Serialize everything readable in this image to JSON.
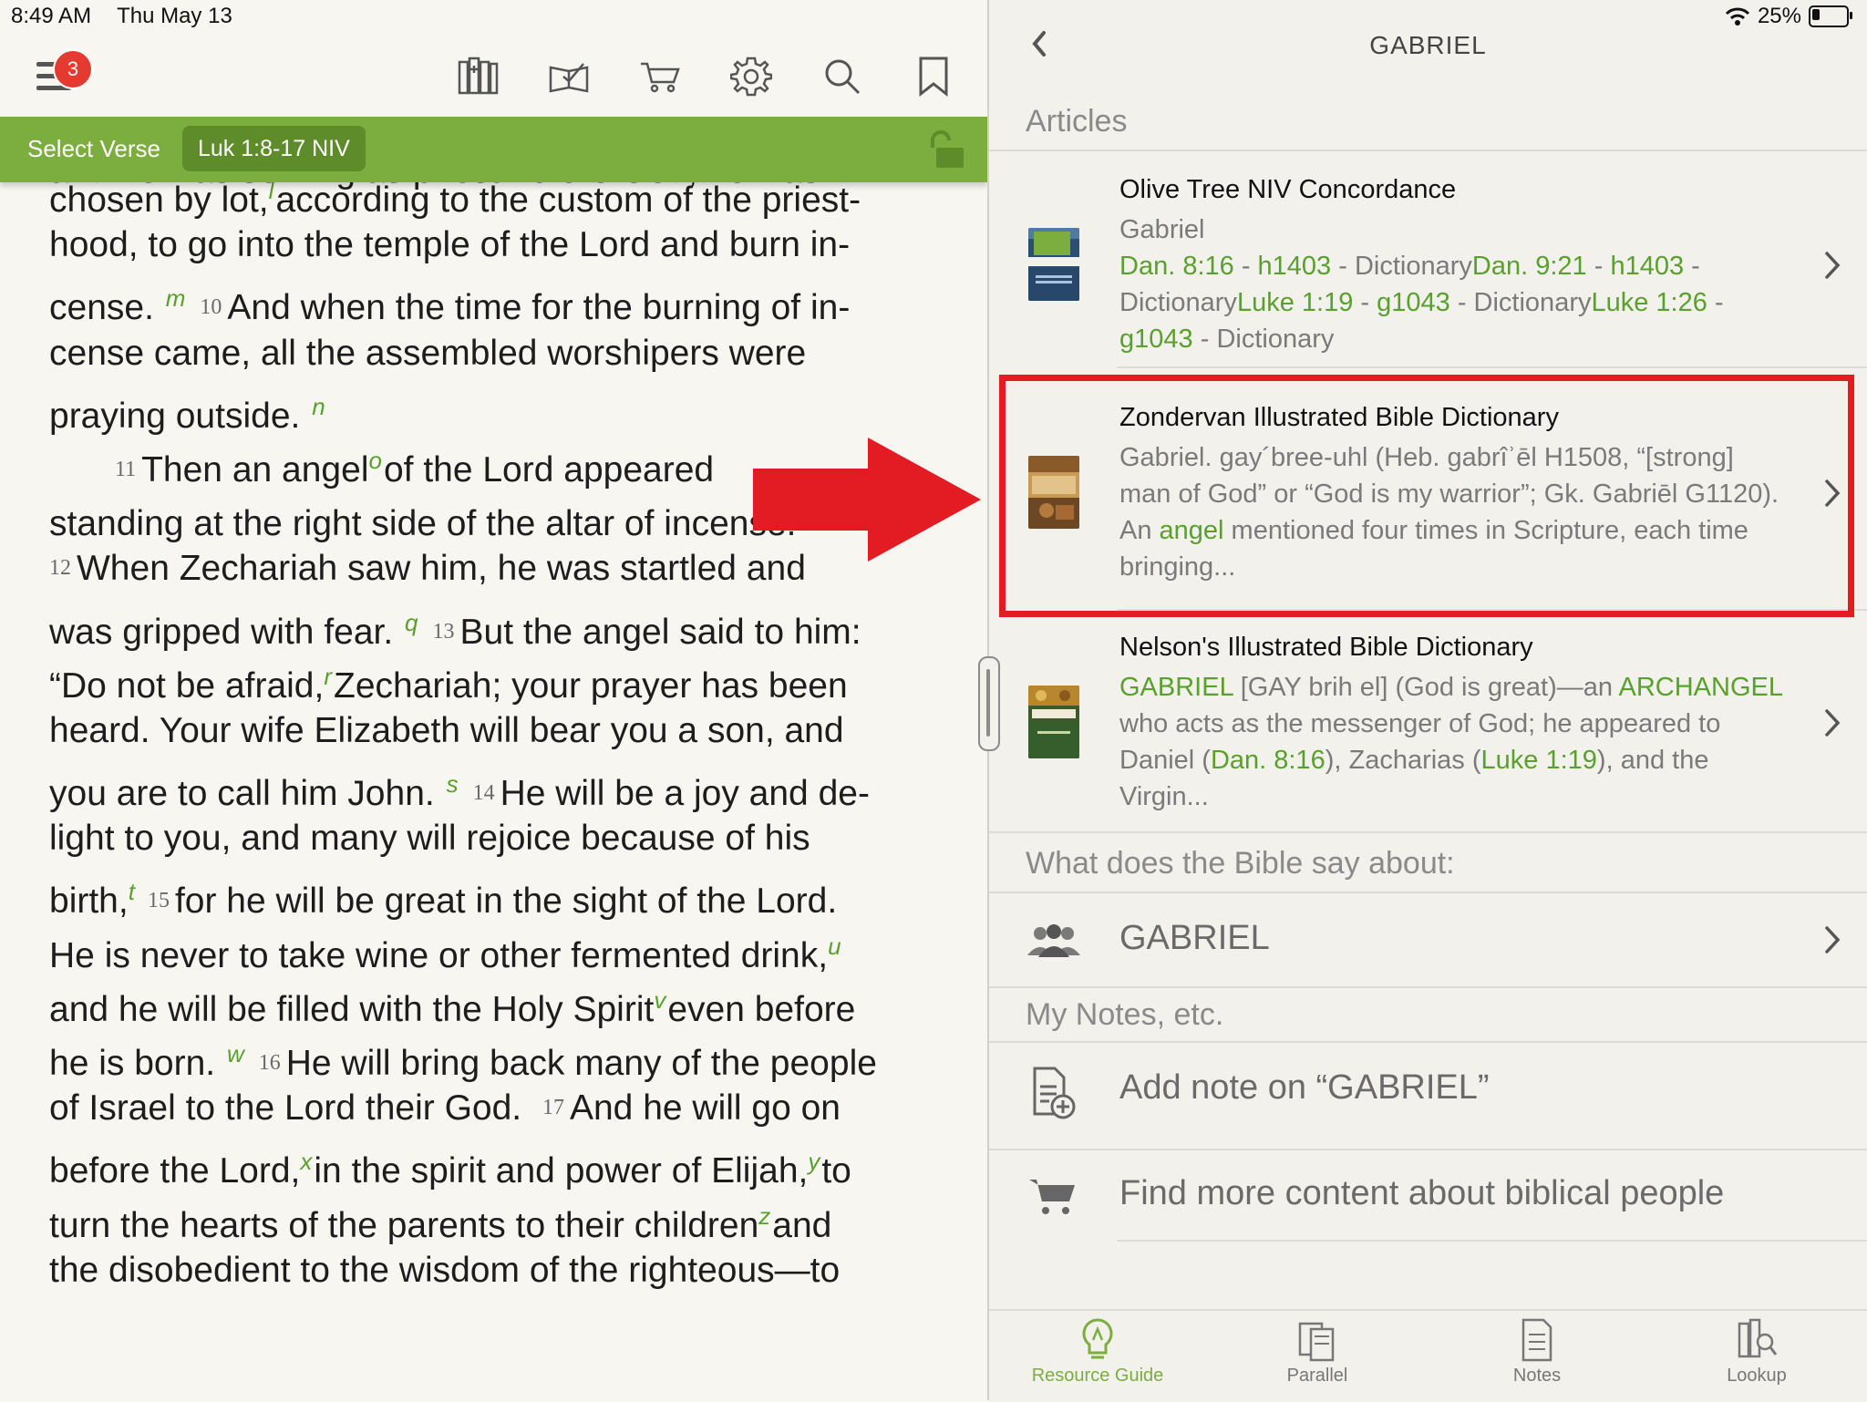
{
  "status": {
    "time": "8:49 AM",
    "date": "Thu May 13",
    "battery": "25%"
  },
  "toolbar": {
    "badge_count": "3"
  },
  "verse_bar": {
    "select_label": "Select Verse",
    "reference": "Luk 1:8-17 NIV"
  },
  "bible": {
    "cut_line": "and he was serving as priest before God,      he was",
    "l1a": "chosen by lot,",
    "l1fn": "l",
    "l1b": "according to the custom of the priest-",
    "l2": "hood, to go into the temple of the Lord and burn in-",
    "l3a": "cense.",
    "l3fn": "m",
    "l3vn": "10",
    "l3b": "And when the time for the burning of in-",
    "l4": "cense came, all the assembled worshipers were",
    "l5a": "praying outside.",
    "l5fn": "n",
    "l6vn": "11",
    "l6a": "Then an angel",
    "l6fn": "o",
    "l6b": "of the Lord appeared",
    "l7a": "standing at the right side of the altar of incense.",
    "l7fn": "p",
    "l8vn": "12",
    "l8a": "When Zechariah saw him, he was startled and",
    "l9a": "was gripped with fear.",
    "l9fn": "q",
    "l9vn": "13",
    "l9b": "But the angel said to him:",
    "l10a": "“Do not be afraid,",
    "l10fn": "r",
    "l10b": "Zechariah; your prayer has been",
    "l11": "heard.  Your wife Elizabeth will bear you a son, and",
    "l12a": "you are to call him John.",
    "l12fn": "s",
    "l12vn": "14",
    "l12b": "He will be a joy and de-",
    "l13": "light to you, and many will rejoice because of his",
    "l14a": "birth,",
    "l14fn": "t",
    "l14vn": "15",
    "l14b": "for he will be great in the sight of the Lord.",
    "l15a": "He is never to take wine or other fermented drink,",
    "l15fn": "u",
    "l16a": "and he will be filled with the Holy Spirit",
    "l16fn": "v",
    "l16b": "even before",
    "l17a": "he is born.",
    "l17fn": "w",
    "l17vn": "16",
    "l17b": "He will bring back many of the people",
    "l18a": "of Israel to the Lord their God.",
    "l18vn": "17",
    "l18b": "And he will go on",
    "l19a": "before the Lord,",
    "l19fn": "x",
    "l19b": "in the spirit and power of Elijah,",
    "l19fn2": "y",
    "l19c": "to",
    "l20a": "turn the hearts of the parents to their children",
    "l20fn": "z",
    "l20b": "and",
    "l21": "the disobedient to the wisdom of the righteous—to"
  },
  "panel": {
    "title": "GABRIEL",
    "articles_label": "Articles",
    "articles": [
      {
        "title": "Olive Tree NIV Concordance",
        "word": "Gabriel",
        "r1": "Dan. 8:16",
        "r1s": "h1403",
        "r2": "Dan. 9:21",
        "r2s": "h1403",
        "r3": "Luke 1:19",
        "r3s": "g1043",
        "r4": "Luke 1:26",
        "r4s": "g1043",
        "dict": "Dictionary",
        "sep": " - "
      },
      {
        "title": "Zondervan Illustrated Bible Dictionary",
        "line1": "Gabriel. gay´bree-uhl (Heb. gabrîʾēl H1508, “[strong]",
        "line2": "man of God” or “God is my warrior”; Gk. Gabriēl G1120).",
        "line3a": "An ",
        "line3link": "angel",
        "line3b": " mentioned four times in Scripture, each time",
        "line4": "bringing..."
      },
      {
        "title": "Nelson's Illustrated Bible Dictionary",
        "l1link": "GABRIEL",
        "l1a": " [GAY brih el] (God is great)—an ",
        "l1link2": "ARCHANGEL",
        "l2": "who acts as the messenger of God; he appeared to",
        "l3a": "Daniel (",
        "l3link": "Dan. 8:16",
        "l3b": "), Zacharias (",
        "l3link2": "Luke 1:19",
        "l3c": "), and the",
        "l4": "Virgin..."
      }
    ],
    "bible_say_label": "What does the Bible say about:",
    "topic": "GABRIEL",
    "notes_label": "My Notes, etc.",
    "add_note": "Add note on “GABRIEL”",
    "find_more": "Find more content about biblical people"
  },
  "tabs": [
    {
      "label": "Resource Guide"
    },
    {
      "label": "Parallel"
    },
    {
      "label": "Notes"
    },
    {
      "label": "Lookup"
    }
  ],
  "colors": {
    "green": "#7cad3f",
    "link_green": "#5aa02c",
    "badge_red": "#e53a30",
    "highlight_red": "#e31b23"
  }
}
